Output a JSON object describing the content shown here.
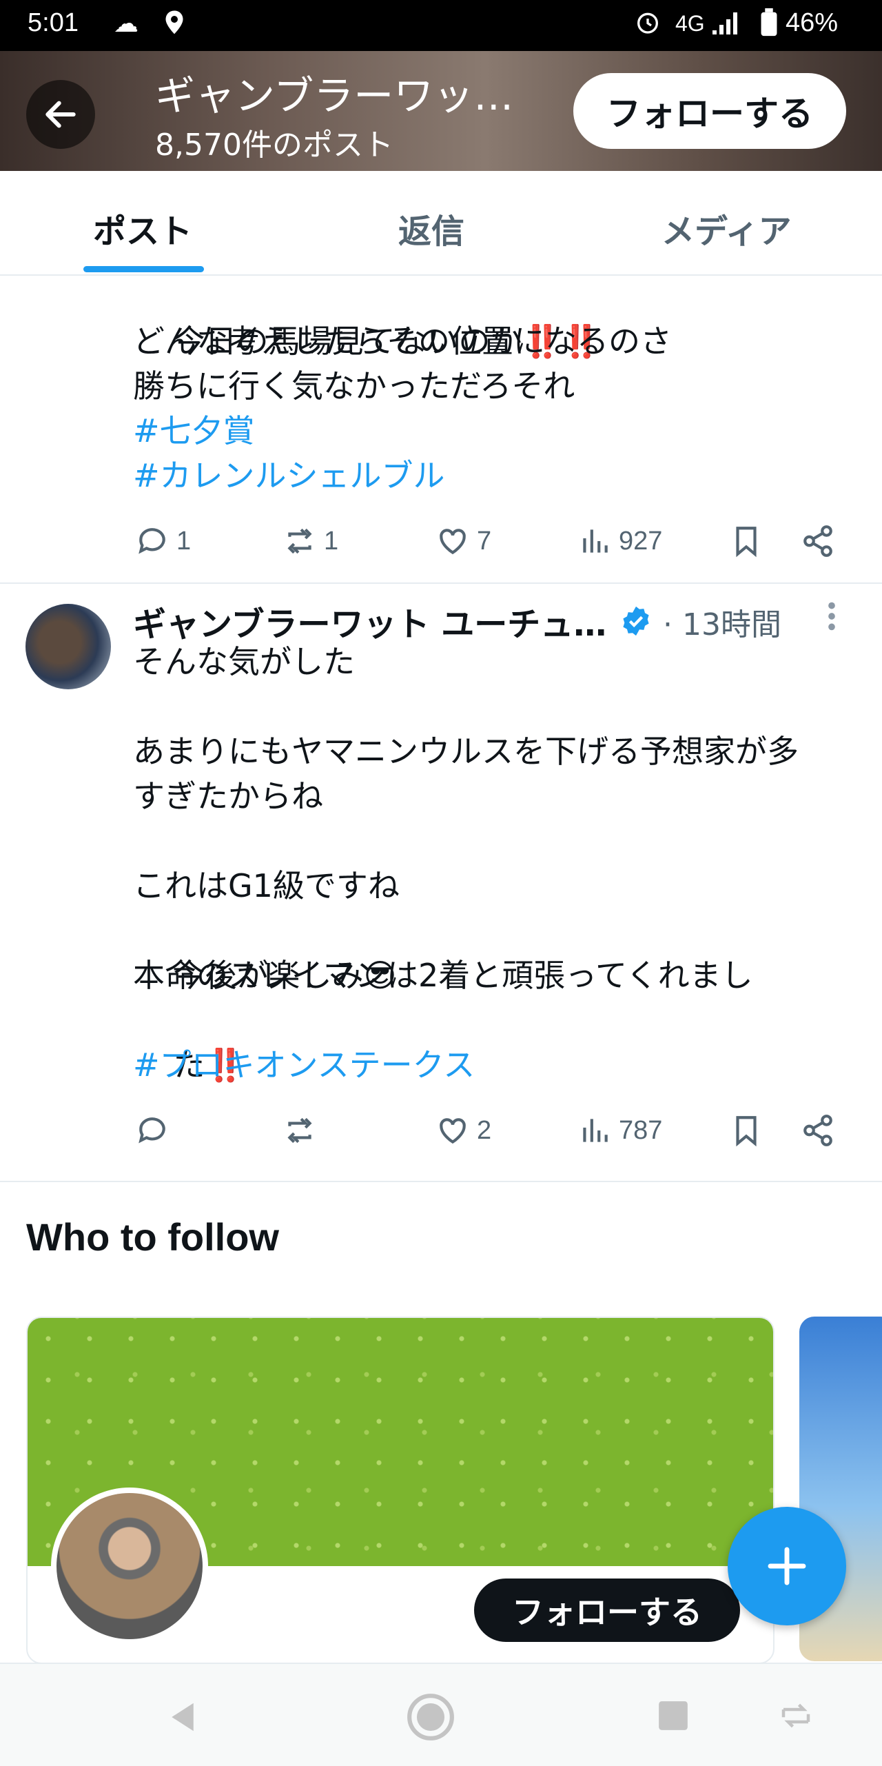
{
  "status_bar": {
    "time": "5:01",
    "network": "4G",
    "battery": "46%"
  },
  "header": {
    "title": "ギャンブラーワッ…",
    "subtitle": "8,570件のポスト",
    "follow_label": "フォローする"
  },
  "tabs": [
    {
      "label": "ポスト"
    },
    {
      "label": "返信"
    },
    {
      "label": "メディア"
    }
  ],
  "tweet1": {
    "lines": [
      "今日の馬場見てないのか",
      "どんな考えしたらその位置になるのさ",
      "勝ちに行く気なかっただろそれ"
    ],
    "emphasis": "‼️‼️",
    "hashtags": [
      "#七夕賞",
      "#カレンルシェルブル"
    ],
    "replies": "1",
    "retweets": "1",
    "likes": "7",
    "views": "927"
  },
  "tweet2": {
    "author": "ギャンブラーワット ユーチュ…",
    "time": "· 13時間",
    "lines": [
      "そんな気がした",
      "",
      "あまりにもヤマニンウルスを下げる予想家が多",
      "すぎたからね",
      "",
      "これはG1級ですね",
      "今後が楽しみ",
      "本命のスレイマンは2着と頑張ってくれまし",
      "た"
    ],
    "emoji": "😎",
    "emphasis": "‼️",
    "hashtag": "#プロキオンステークス",
    "replies": "",
    "retweets": "",
    "likes": "2",
    "views": "787"
  },
  "who_to_follow": {
    "title": "Who to follow",
    "follow_label": "フォローする"
  },
  "colors": {
    "accent": "#1d9bf0",
    "text": "#0f1419",
    "muted": "#536471"
  }
}
